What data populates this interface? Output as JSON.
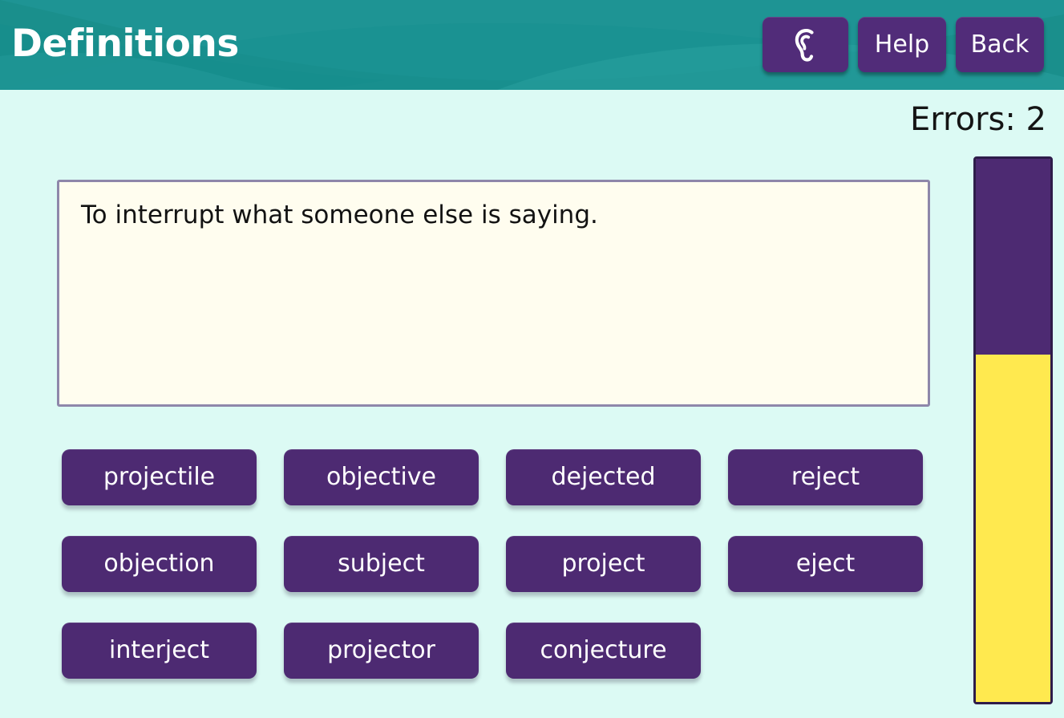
{
  "header": {
    "title": "Definitions",
    "background_color": "#1a8f8c",
    "buttons": [
      {
        "name": "listen",
        "icon": "ear-icon",
        "label": ""
      },
      {
        "name": "help",
        "icon": "",
        "label": "Help"
      },
      {
        "name": "back",
        "icon": "",
        "label": "Back"
      }
    ],
    "button_color": "#512c79"
  },
  "status": {
    "errors_text": "Errors: 2",
    "errors_count": 2
  },
  "definition": {
    "text": "To interrupt what someone else is saying.",
    "background_color": "#fffdef",
    "border_color": "#8e87aa"
  },
  "answers": {
    "button_color": "#4d2a72",
    "rows": [
      {
        "words": [
          "projectile",
          "objective",
          "dejected",
          "reject"
        ]
      },
      {
        "words": [
          "objection",
          "subject",
          "project",
          "eject"
        ]
      },
      {
        "words": [
          "interject",
          "projector",
          "conjecture"
        ]
      }
    ]
  },
  "progress": {
    "remaining_color": "#4d2a72",
    "complete_color": "#ffe94f",
    "complete_percent": 64,
    "remaining_percent": 36
  },
  "page": {
    "background_color": "#dcfaf4"
  }
}
